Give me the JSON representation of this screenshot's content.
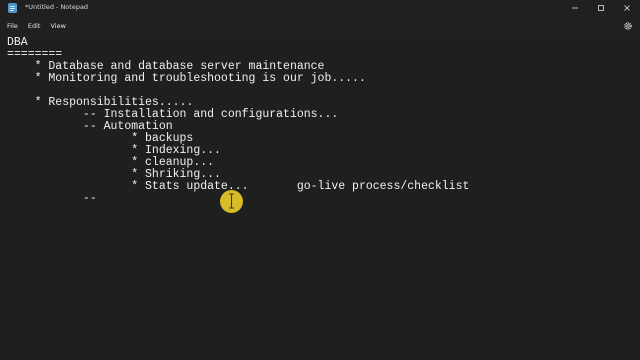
{
  "window": {
    "title": "*Untitled - Notepad"
  },
  "menu": {
    "items": [
      "File",
      "Edit",
      "View"
    ]
  },
  "icons": {
    "app": "notepad-icon",
    "minimize": "minimize-icon",
    "maximize": "maximize-icon",
    "close": "close-icon",
    "settings": "gear-icon",
    "cursor": "text-cursor-icon"
  },
  "colors": {
    "background": "#1f1f1f",
    "chrome": "#202020",
    "text": "#f0f0f0",
    "cursor_highlight": "#ffdf28"
  },
  "editor": {
    "lines": [
      "DBA",
      "========",
      "    * Database and database server maintenance",
      "    * Monitoring and troubleshooting is our job.....",
      "",
      "    * Responsibilities.....",
      "           -- Installation and configurations...",
      "           -- Automation",
      "                  * backups",
      "                  * Indexing...",
      "                  * cleanup...",
      "                  * Shriking...",
      "                  * Stats update...       go-live process/checklist",
      "           --"
    ]
  }
}
